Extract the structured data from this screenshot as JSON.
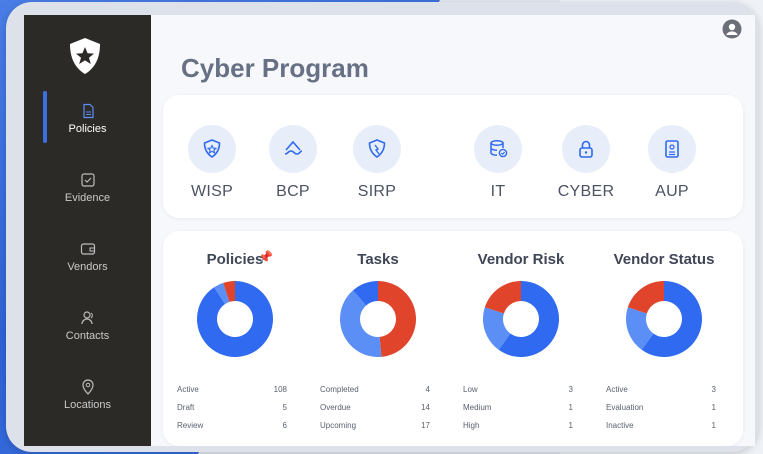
{
  "colors": {
    "accent": "#2f6af0",
    "light_blue": "#5b8ff5",
    "red": "#e0452c",
    "sidebar": "#2b2a26"
  },
  "app": {
    "title": "Cyber Program"
  },
  "sidebar": {
    "items": [
      {
        "label": "Policies",
        "icon": "policy-document-icon",
        "active": true
      },
      {
        "label": "Evidence",
        "icon": "evidence-check-icon"
      },
      {
        "label": "Vendors",
        "icon": "vendor-wallet-icon"
      },
      {
        "label": "Contacts",
        "icon": "contacts-icon"
      },
      {
        "label": "Locations",
        "icon": "location-pin-icon"
      }
    ]
  },
  "programs": [
    {
      "label": "WISP",
      "icon": "shield-star-icon"
    },
    {
      "label": "BCP",
      "icon": "continuity-icon"
    },
    {
      "label": "SIRP",
      "icon": "incident-shield-icon"
    },
    {
      "label": "IT",
      "icon": "database-check-icon"
    },
    {
      "label": "CYBER",
      "icon": "lock-icon"
    },
    {
      "label": "AUP",
      "icon": "badge-doc-icon"
    }
  ],
  "chart_data": [
    {
      "type": "pie",
      "title": "Policies",
      "categories": [
        "Active",
        "Draft",
        "Review"
      ],
      "values": [
        108,
        5,
        6
      ]
    },
    {
      "type": "pie",
      "title": "Tasks",
      "categories": [
        "Completed",
        "Overdue",
        "Upcoming"
      ],
      "values": [
        4,
        14,
        17
      ]
    },
    {
      "type": "pie",
      "title": "Vendor Risk",
      "categories": [
        "Low",
        "Medium",
        "High"
      ],
      "values": [
        3,
        1,
        1
      ]
    },
    {
      "type": "pie",
      "title": "Vendor Status",
      "categories": [
        "Active",
        "Evaluation",
        "Inactive"
      ],
      "values": [
        3,
        1,
        1
      ]
    }
  ]
}
